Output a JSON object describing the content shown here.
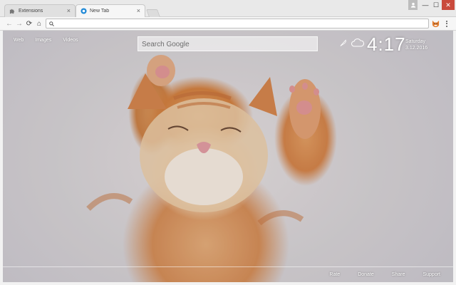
{
  "tabs": [
    {
      "label": "Extensions",
      "icon": "puzzle-icon",
      "close": "×"
    },
    {
      "label": "New Tab",
      "icon": "tab-favicon-icon",
      "close": "×"
    }
  ],
  "window_controls": {
    "minimize": "—",
    "maximize": "☐",
    "close": "✕"
  },
  "toolbar": {
    "back": "←",
    "forward": "→",
    "reload": "⟳",
    "home": "⌂",
    "address_value": "",
    "address_icon": "search-icon"
  },
  "page": {
    "nav": [
      "Web",
      "Images",
      "Videos"
    ],
    "search_placeholder": "Search Google",
    "time": "4:17",
    "day": "Saturday",
    "date": "3.12.2016",
    "footer": [
      "Rate",
      "Donate",
      "Share",
      "Support"
    ]
  },
  "colors": {
    "close_button": "#c94a3c",
    "tab_favicon": "#1e88d6"
  }
}
